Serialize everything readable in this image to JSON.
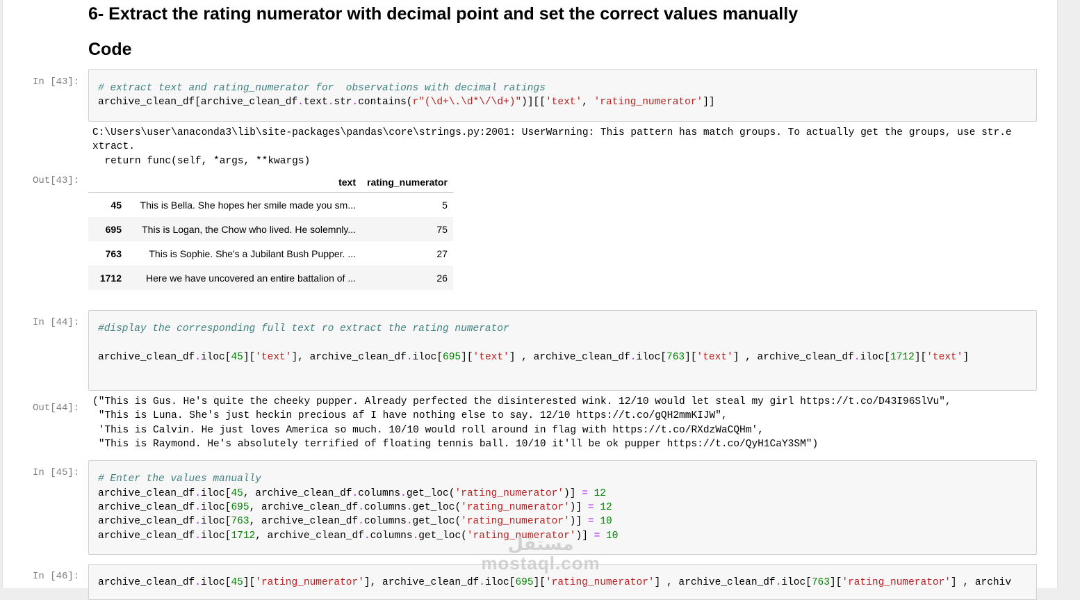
{
  "heading": "6- Extract the rating numerator with decimal point and set the correct values manually",
  "subheading": "Code",
  "cells": {
    "c43": {
      "in_prompt": "In [43]:",
      "out_prompt": "Out[43]:",
      "line1": "# extract text and rating_numerator for  observations with decimal ratings",
      "line2": "archive_clean_df[archive_clean_df.text.str.contains(r\"(\\d+\\.\\d*\\/\\d+)\")][['text', 'rating_numerator']]",
      "stderr1": "C:\\Users\\user\\anaconda3\\lib\\site-packages\\pandas\\core\\strings.py:2001: UserWarning: This pattern has match groups. To actually get the groups, use str.e",
      "stderr2": "xtract.",
      "stderr3": "  return func(self, *args, **kwargs)",
      "table": {
        "columns": [
          "",
          "text",
          "rating_numerator"
        ],
        "rows": [
          {
            "index": "45",
            "text": "This is Bella. She hopes her smile made you sm...",
            "rating_numerator": "5"
          },
          {
            "index": "695",
            "text": "This is Logan, the Chow who lived. He solemnly...",
            "rating_numerator": "75"
          },
          {
            "index": "763",
            "text": "This is Sophie. She's a Jubilant Bush Pupper. ...",
            "rating_numerator": "27"
          },
          {
            "index": "1712",
            "text": "Here we have uncovered an entire battalion of ...",
            "rating_numerator": "26"
          }
        ]
      }
    },
    "c44": {
      "in_prompt": "In [44]:",
      "out_prompt": "Out[44]:",
      "line1": "#display the corresponding full text ro extract the rating numerator",
      "line2": "archive_clean_df.iloc[45]['text'], archive_clean_df.iloc[695]['text'] , archive_clean_df.iloc[763]['text'] , archive_clean_df.iloc[1712]['text']",
      "out1": "(\"This is Gus. He's quite the cheeky pupper. Already perfected the disinterested wink. 12/10 would let steal my girl https://t.co/D43I96SlVu\",",
      "out2": " \"This is Luna. She's just heckin precious af I have nothing else to say. 12/10 https://t.co/gQH2mmKIJW\",",
      "out3": " 'This is Calvin. He just loves America so much. 10/10 would roll around in flag with https://t.co/RXdzWaCQHm',",
      "out4": " \"This is Raymond. He's absolutely terrified of floating tennis ball. 10/10 it'll be ok pupper https://t.co/QyH1CaY3SM\")"
    },
    "c45": {
      "in_prompt": "In [45]:",
      "line1": "# Enter the values manually",
      "line2": "archive_clean_df.iloc[45, archive_clean_df.columns.get_loc('rating_numerator')] = 12",
      "line3": "archive_clean_df.iloc[695, archive_clean_df.columns.get_loc('rating_numerator')] = 12",
      "line4": "archive_clean_df.iloc[763, archive_clean_df.columns.get_loc('rating_numerator')] = 10",
      "line5": "archive_clean_df.iloc[1712, archive_clean_df.columns.get_loc('rating_numerator')] = 10"
    },
    "c46": {
      "in_prompt": "In [46]:",
      "line1": "archive_clean_df.iloc[45]['rating_numerator'], archive_clean_df.iloc[695]['rating_numerator'] , archive_clean_df.iloc[763]['rating_numerator'] , archiv"
    }
  },
  "watermark": {
    "arabic": "مستقل",
    "latin": "mostaql.com"
  },
  "colors": {
    "comment": "#408080",
    "string": "#ba2121",
    "number": "#008000",
    "operator": "#aa22ff",
    "prompt": "#7f7f7f",
    "code_bg": "#f7f7f7"
  }
}
